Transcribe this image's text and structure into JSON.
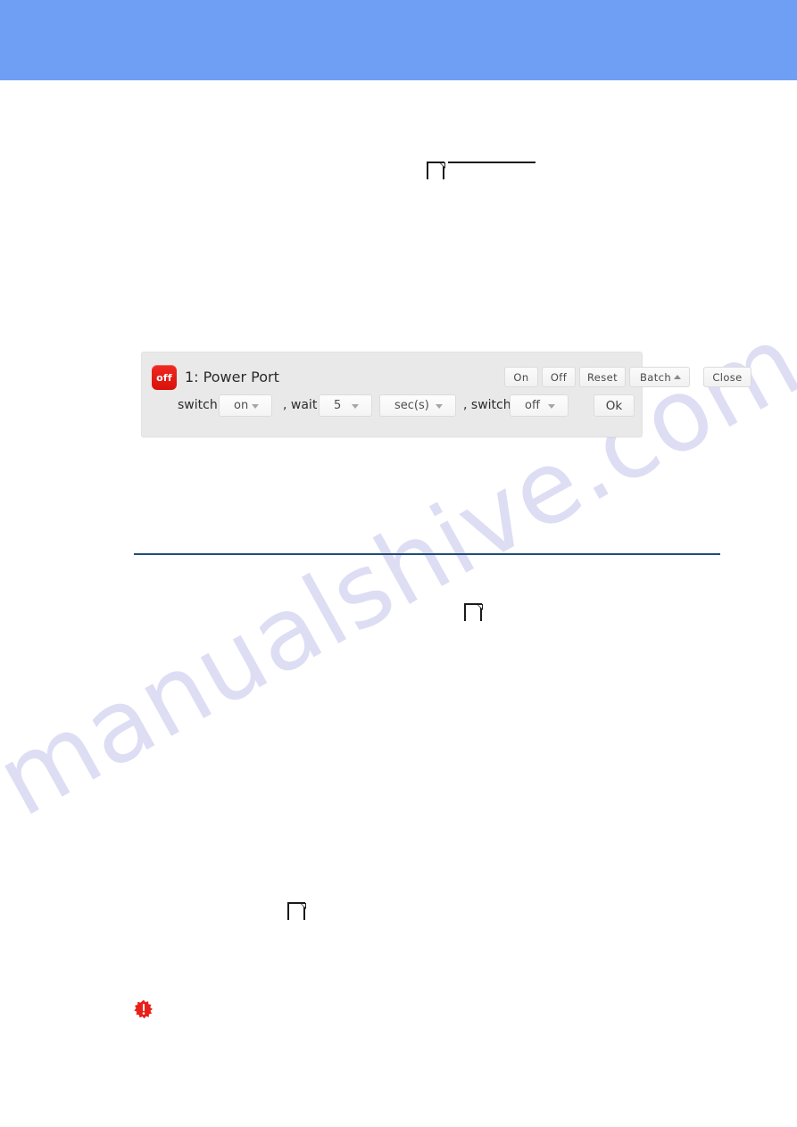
{
  "banner": {
    "color": "#6f9ef5"
  },
  "decorations": {
    "page_icon_name": "page-document-icon",
    "divider_color": "#1f4e79",
    "warning_icon_name": "red-starburst-warning-icon",
    "warning_icon_color": "#e8201a"
  },
  "watermark": {
    "text": "manualshive.com"
  },
  "panel": {
    "status_badge": "off",
    "status_badge_color": "#e8201a",
    "title": "1: Power Port",
    "buttons": [
      {
        "id": "on",
        "label": "On"
      },
      {
        "id": "off",
        "label": "Off"
      },
      {
        "id": "reset",
        "label": "Reset"
      },
      {
        "id": "batch",
        "label": "Batch"
      },
      {
        "id": "close",
        "label": "Close"
      }
    ],
    "batch_row": {
      "label_switch_1": "switch",
      "value_switch_1": "on",
      "label_wait": ", wait",
      "value_wait": "5",
      "value_unit": "sec(s)",
      "label_switch_2": ", switch",
      "value_switch_2": "off",
      "ok_label": "Ok"
    }
  }
}
